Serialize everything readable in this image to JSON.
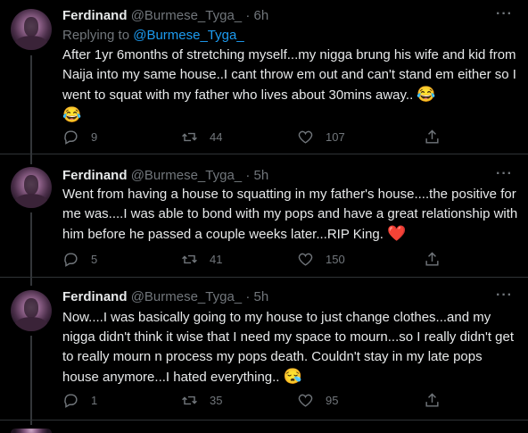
{
  "tweets": [
    {
      "name": "Ferdinand",
      "handle": "@Burmese_Tyga_",
      "dot": "·",
      "time": "6h",
      "replying_prefix": "Replying to ",
      "replying_handle": "@Burmese_Tyga_",
      "text": "After 1yr 6months of stretching myself...my nigga brung his wife and kid from Naija into my same house..I cant throw em out and can't stand em either so I went to squat with my father who lives about 30mins away..",
      "emoji": "😂\n😂",
      "replies": "9",
      "retweets": "44",
      "likes": "107"
    },
    {
      "name": "Ferdinand",
      "handle": "@Burmese_Tyga_",
      "dot": "·",
      "time": "5h",
      "text": "Went from having a house to squatting in my father's house....the positive for me was....I was able to bond with my pops and have a great relationship with him before he passed a couple weeks later...RIP King.",
      "emoji": "❤️",
      "replies": "5",
      "retweets": "41",
      "likes": "150"
    },
    {
      "name": "Ferdinand",
      "handle": "@Burmese_Tyga_",
      "dot": "·",
      "time": "5h",
      "text": "Now....I was basically going to my house to just change clothes...and my nigga didn't think it wise that I need my space to mourn...so I really didn't get to really mourn n process my pops death. Couldn't stay in my late pops house anymore...I hated everything..",
      "emoji": "😪",
      "replies": "1",
      "retweets": "35",
      "likes": "95"
    }
  ],
  "more_label": "···",
  "colors": {
    "background": "#000000",
    "text": "#e7e9ea",
    "secondary": "#71767b",
    "link": "#1d9bf0",
    "heart": "#f91880"
  },
  "icons": [
    "reply-icon",
    "retweet-icon",
    "like-icon",
    "share-icon",
    "more-icon"
  ]
}
